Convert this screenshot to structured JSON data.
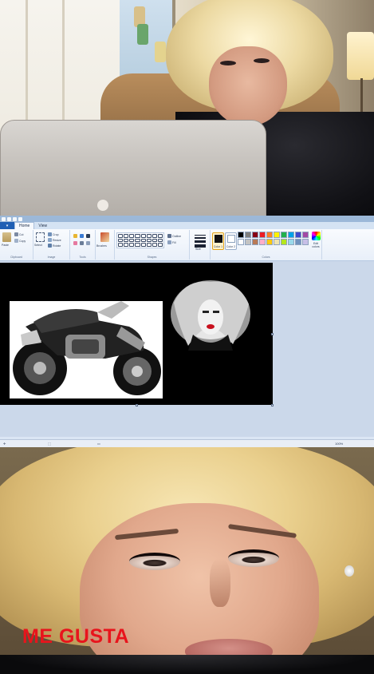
{
  "paint": {
    "tabs": [
      "Home",
      "View"
    ],
    "active_tab": "Home",
    "clipboard": {
      "paste_label": "Paste",
      "cut_label": "Cut",
      "copy_label": "Copy",
      "group_label": "Clipboard"
    },
    "image": {
      "select_label": "Select",
      "crop_label": "Crop",
      "resize_label": "Resize",
      "rotate_label": "Rotate",
      "group_label": "Image"
    },
    "tools": {
      "group_label": "Tools"
    },
    "brushes": {
      "label": "Brushes"
    },
    "shapes": {
      "outline_label": "Outline",
      "fill_label": "Fill",
      "group_label": "Shapes"
    },
    "size": {
      "label": "Size"
    },
    "colors": {
      "color1_label": "Color 1",
      "color2_label": "Color 2",
      "color1_value": "#111111",
      "color2_value": "#ffffff",
      "edit_label": "Edit colors",
      "group_label": "Colors",
      "palette": [
        "#000000",
        "#7f7f7f",
        "#880015",
        "#ed1c24",
        "#ff7f27",
        "#fff200",
        "#22b14c",
        "#00a2e8",
        "#3f48cc",
        "#a349a4",
        "#ffffff",
        "#c3c3c3",
        "#b97a57",
        "#ffaec9",
        "#ffc90e",
        "#efe4b0",
        "#b5e61d",
        "#99d9ea",
        "#7092be",
        "#c8bfe7"
      ]
    },
    "status": {
      "zoom": "100%"
    }
  },
  "caption": {
    "text": "ME GUSTA",
    "color": "#e8141c"
  }
}
